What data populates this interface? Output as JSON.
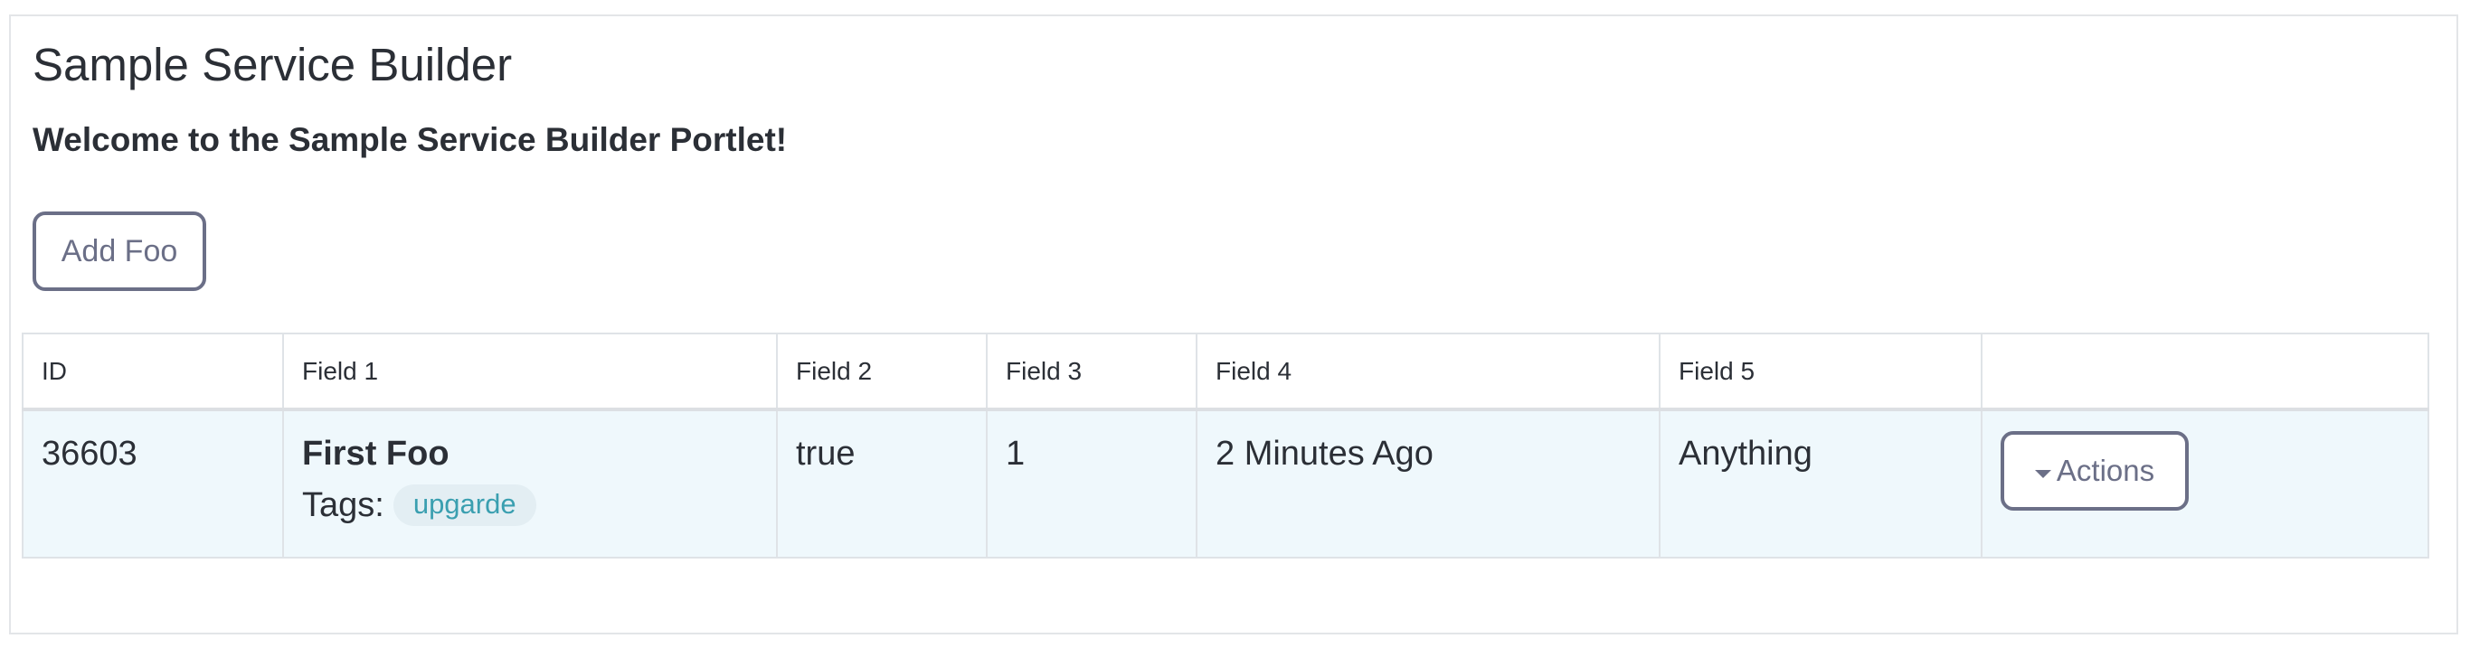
{
  "portlet": {
    "title": "Sample Service Builder",
    "welcome": "Welcome to the Sample Service Builder Portlet!",
    "add_button_label": "Add Foo"
  },
  "table": {
    "headers": {
      "id": "ID",
      "field1": "Field 1",
      "field2": "Field 2",
      "field3": "Field 3",
      "field4": "Field 4",
      "field5": "Field 5",
      "actions": ""
    },
    "rows": [
      {
        "id": "36603",
        "field1": "First Foo",
        "tags_label": "Tags:",
        "tags": [
          "upgarde"
        ],
        "field2": "true",
        "field3": "1",
        "field4": "2 Minutes Ago",
        "field5": "Anything",
        "actions_label": "Actions",
        "actions_icon": "caret-down-icon"
      }
    ]
  },
  "colors": {
    "button_border": "#6b6f87",
    "row_background": "#eff8fc",
    "tag_text": "#3a9fb0",
    "tag_background": "#e3eef3"
  }
}
